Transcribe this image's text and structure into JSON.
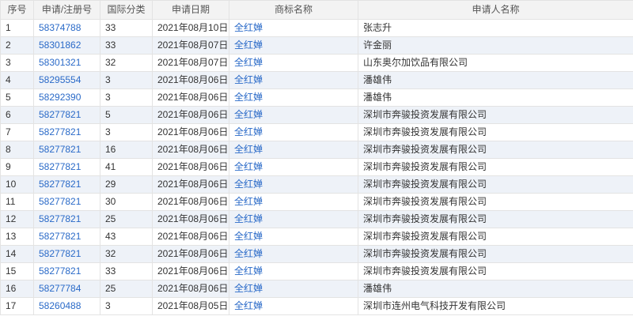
{
  "headers": [
    "序号",
    "申请/注册号",
    "国际分类",
    "申请日期",
    "商标名称",
    "申请人名称"
  ],
  "rows": [
    {
      "no": "1",
      "reg": "58374788",
      "cls": "33",
      "date": "2021年08月10日",
      "mark": "全红婵",
      "applicant": "张志升"
    },
    {
      "no": "2",
      "reg": "58301862",
      "cls": "33",
      "date": "2021年08月07日",
      "mark": "全红婵",
      "applicant": "许金丽"
    },
    {
      "no": "3",
      "reg": "58301321",
      "cls": "32",
      "date": "2021年08月07日",
      "mark": "全红婵",
      "applicant": "山东奥尔加饮品有限公司"
    },
    {
      "no": "4",
      "reg": "58295554",
      "cls": "3",
      "date": "2021年08月06日",
      "mark": "全红婵",
      "applicant": "潘雄伟"
    },
    {
      "no": "5",
      "reg": "58292390",
      "cls": "3",
      "date": "2021年08月06日",
      "mark": "全红婵",
      "applicant": "潘雄伟"
    },
    {
      "no": "6",
      "reg": "58277821",
      "cls": "5",
      "date": "2021年08月06日",
      "mark": "全红婵",
      "applicant": "深圳市奔骏投资发展有限公司"
    },
    {
      "no": "7",
      "reg": "58277821",
      "cls": "3",
      "date": "2021年08月06日",
      "mark": "全红婵",
      "applicant": "深圳市奔骏投资发展有限公司"
    },
    {
      "no": "8",
      "reg": "58277821",
      "cls": "16",
      "date": "2021年08月06日",
      "mark": "全红婵",
      "applicant": "深圳市奔骏投资发展有限公司"
    },
    {
      "no": "9",
      "reg": "58277821",
      "cls": "41",
      "date": "2021年08月06日",
      "mark": "全红婵",
      "applicant": "深圳市奔骏投资发展有限公司"
    },
    {
      "no": "10",
      "reg": "58277821",
      "cls": "29",
      "date": "2021年08月06日",
      "mark": "全红婵",
      "applicant": "深圳市奔骏投资发展有限公司"
    },
    {
      "no": "11",
      "reg": "58277821",
      "cls": "30",
      "date": "2021年08月06日",
      "mark": "全红婵",
      "applicant": "深圳市奔骏投资发展有限公司"
    },
    {
      "no": "12",
      "reg": "58277821",
      "cls": "25",
      "date": "2021年08月06日",
      "mark": "全红婵",
      "applicant": "深圳市奔骏投资发展有限公司"
    },
    {
      "no": "13",
      "reg": "58277821",
      "cls": "43",
      "date": "2021年08月06日",
      "mark": "全红婵",
      "applicant": "深圳市奔骏投资发展有限公司"
    },
    {
      "no": "14",
      "reg": "58277821",
      "cls": "32",
      "date": "2021年08月06日",
      "mark": "全红婵",
      "applicant": "深圳市奔骏投资发展有限公司"
    },
    {
      "no": "15",
      "reg": "58277821",
      "cls": "33",
      "date": "2021年08月06日",
      "mark": "全红婵",
      "applicant": "深圳市奔骏投资发展有限公司"
    },
    {
      "no": "16",
      "reg": "58277784",
      "cls": "25",
      "date": "2021年08月06日",
      "mark": "全红婵",
      "applicant": "潘雄伟"
    },
    {
      "no": "17",
      "reg": "58260488",
      "cls": "3",
      "date": "2021年08月05日",
      "mark": "全红婵",
      "applicant": "深圳市连州电气科技开发有限公司"
    }
  ],
  "colors": {
    "link": "#2a6ac8",
    "header_bg": "#f3f3f3",
    "stripe_bg": "#eef2f8",
    "border": "#e3e3e3"
  }
}
